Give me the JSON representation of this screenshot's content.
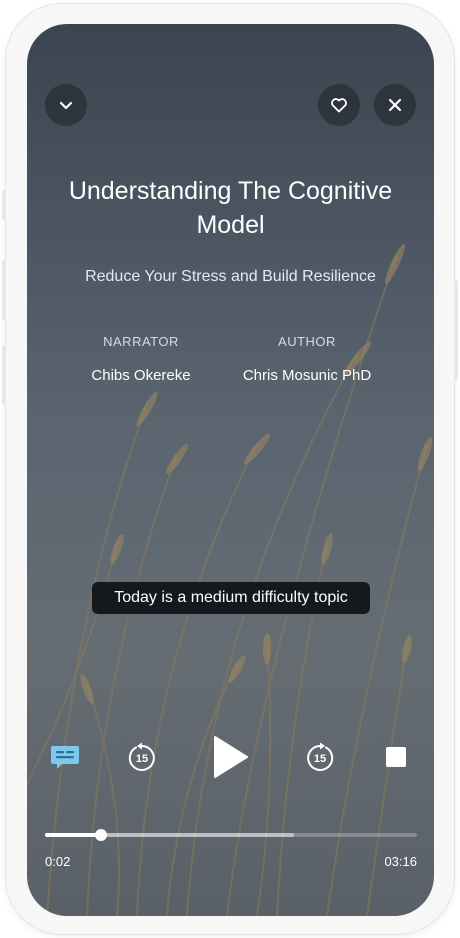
{
  "header": {
    "collapse_icon": "chevron-down-icon",
    "favorite_icon": "heart-icon",
    "close_icon": "close-icon"
  },
  "session": {
    "title": "Understanding The Cognitive Model",
    "subtitle": "Reduce Your Stress and Build Resilience",
    "narrator_label": "NARRATOR",
    "narrator_name": "Chibs Okereke",
    "author_label": "AUTHOR",
    "author_name": "Chris Mosunic PhD"
  },
  "tooltip": {
    "text": "Today is a medium difficulty topic"
  },
  "controls": {
    "captions_icon": "captions-icon",
    "rewind_icon": "rewind-15-icon",
    "rewind_seconds": "15",
    "play_icon": "play-icon",
    "forward_icon": "forward-15-icon",
    "forward_seconds": "15",
    "stop_icon": "stop-icon",
    "accent_color": "#7ec8f0"
  },
  "progress": {
    "elapsed": "0:02",
    "total": "03:16",
    "played_fraction": 0.15,
    "buffered_fraction": 0.67
  }
}
